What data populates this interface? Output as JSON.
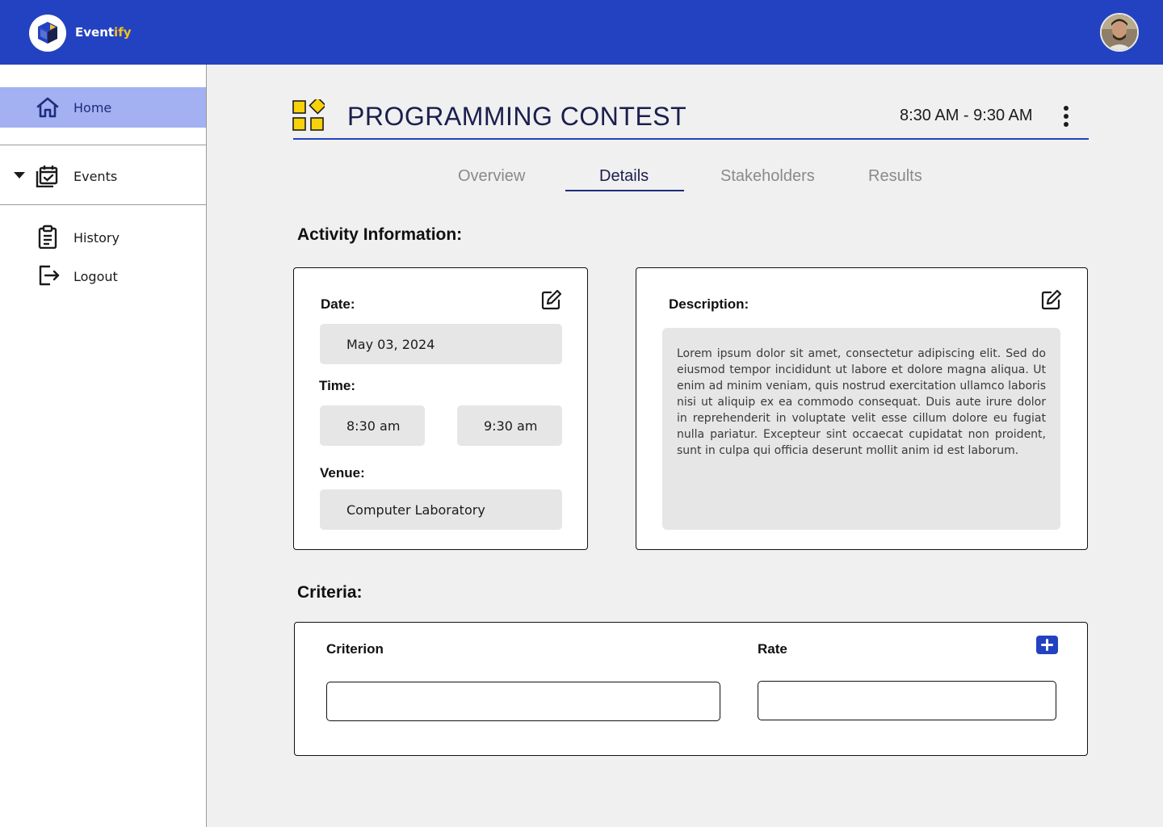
{
  "app": {
    "brand_prefix": "Event",
    "brand_suffix": "ify",
    "accent_color": "#2342c1",
    "brand_highlight_color": "#f7c21b"
  },
  "sidebar": {
    "items": [
      {
        "label": "Home",
        "icon": "home-icon",
        "active": true
      },
      {
        "label": "Events",
        "icon": "calendar-check-icon",
        "expandable": true
      },
      {
        "label": "History",
        "icon": "clipboard-icon"
      },
      {
        "label": "Logout",
        "icon": "logout-icon"
      }
    ]
  },
  "event": {
    "title": "PROGRAMMING CONTEST",
    "time_range": "8:30 AM - 9:30 AM",
    "icon": "category-grid-icon"
  },
  "tabs": [
    {
      "label": "Overview",
      "active": false
    },
    {
      "label": "Details",
      "active": true
    },
    {
      "label": "Stakeholders",
      "active": false
    },
    {
      "label": "Results",
      "active": false
    }
  ],
  "activity": {
    "heading": "Activity Information:",
    "date_label": "Date:",
    "date_value": "May 03, 2024",
    "time_label": "Time:",
    "time_start": "8:30 am",
    "time_end": "9:30 am",
    "venue_label": "Venue:",
    "venue_value": "Computer Laboratory",
    "description_label": "Description:",
    "description_text": "Lorem ipsum dolor sit amet, consectetur adipiscing elit. Sed do eiusmod tempor incididunt ut labore et dolore magna aliqua. Ut enim ad minim veniam, quis nostrud exercitation ullamco laboris nisi ut aliquip ex ea commodo consequat. Duis aute irure dolor in reprehenderit in voluptate velit esse cillum dolore eu fugiat nulla pariatur. Excepteur sint occaecat cupidatat non proident, sunt in culpa qui officia deserunt mollit anim id est laborum."
  },
  "criteria": {
    "heading": "Criteria:",
    "criterion_label": "Criterion",
    "rate_label": "Rate",
    "criterion_value": "",
    "rate_value": ""
  }
}
